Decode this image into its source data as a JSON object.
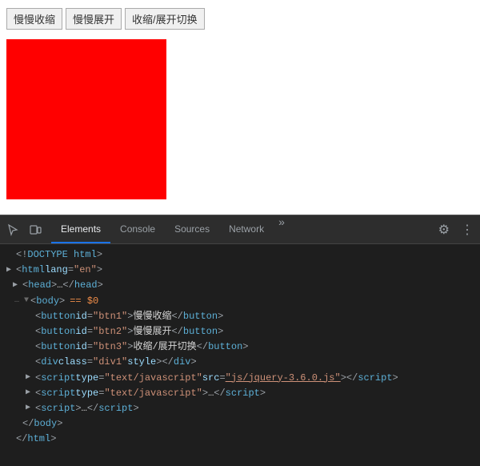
{
  "browser": {
    "buttons": [
      {
        "label": "慢慢收缩",
        "id": "btn1"
      },
      {
        "label": "慢慢展开",
        "id": "btn2"
      },
      {
        "label": "收缩/展开切换",
        "id": "btn3"
      }
    ]
  },
  "devtools": {
    "tabs": [
      {
        "label": "Elements",
        "active": true
      },
      {
        "label": "Console",
        "active": false
      },
      {
        "label": "Sources",
        "active": false
      },
      {
        "label": "Network",
        "active": false
      }
    ],
    "more_label": "»",
    "code": {
      "doctype": "<!DOCTYPE html>",
      "html_open": "<html lang=\"en\">",
      "head_collapsed": "<head>…</head>",
      "body_open": "<body>",
      "body_marker": "== $0",
      "btn1": "<button id=\"btn1\">慢慢收缩</button>",
      "btn2": "<button id=\"btn2\">慢慢展开</button>",
      "btn3": "<button id=\"btn3\">收缩/展开切换</button>",
      "div": "<div class=\"div1\" style></div>",
      "script1": "<script type=\"text/javascript\" src=\"js/jquery-3.6.0.js\"></script>",
      "script2": "<script type=\"text/javascript\">…</script>",
      "script3": "<script>…</script>",
      "body_close": "</body>",
      "html_close": "</html>"
    }
  }
}
